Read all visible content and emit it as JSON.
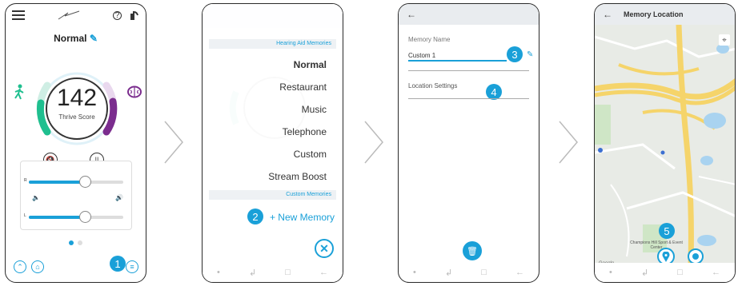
{
  "screen1": {
    "title": "Normal",
    "score": "142",
    "score_label": "Thrive Score",
    "slider_r": "R",
    "slider_l": "L",
    "slider_r_value": 0.58,
    "slider_l_value": 0.58,
    "badge": "1"
  },
  "screen2": {
    "hearing_header": "Hearing Aid Memories",
    "memories": [
      "Normal",
      "Restaurant",
      "Music",
      "Telephone",
      "Custom",
      "Stream Boost"
    ],
    "selected": "Normal",
    "custom_header": "Custom Memories",
    "new_memory": "+ New Memory",
    "badge": "2"
  },
  "screen3": {
    "field_label": "Memory Name",
    "field_value": "Custom 1",
    "location_label": "Location Settings",
    "badge_name": "3",
    "badge_location": "4"
  },
  "screen4": {
    "title": "Memory Location",
    "map_logo": "Google",
    "place_label": "Champions Hill Sport & Event Center",
    "badge": "5"
  },
  "colors": {
    "accent": "#1aa0d8",
    "green": "#1fbf8f",
    "purple": "#7b2d8e"
  }
}
